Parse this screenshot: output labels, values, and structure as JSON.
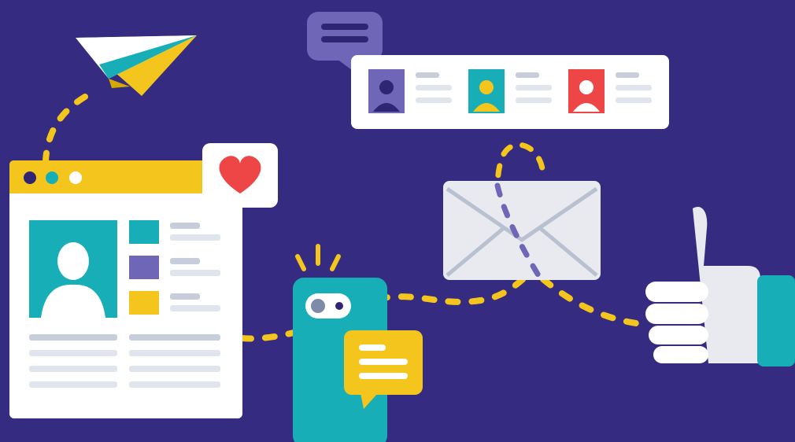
{
  "colors": {
    "background": "#352b80",
    "yellow": "#f4c51c",
    "teal": "#17aeb8",
    "purple": "#7066b8",
    "dark_purple": "#2f2572",
    "red": "#ee4646",
    "light_gray": "#e8eaf0",
    "line_gray": "#c7cddb",
    "white": "#ffffff"
  },
  "illustration": {
    "elements": [
      "paper-plane-icon",
      "chat-bubble-icon",
      "contact-cards-panel",
      "browser-window",
      "heart-like-icon",
      "smartphone",
      "message-bubble-icon",
      "envelope-icon",
      "thumbs-up-icon",
      "dashed-connection-paths"
    ]
  }
}
